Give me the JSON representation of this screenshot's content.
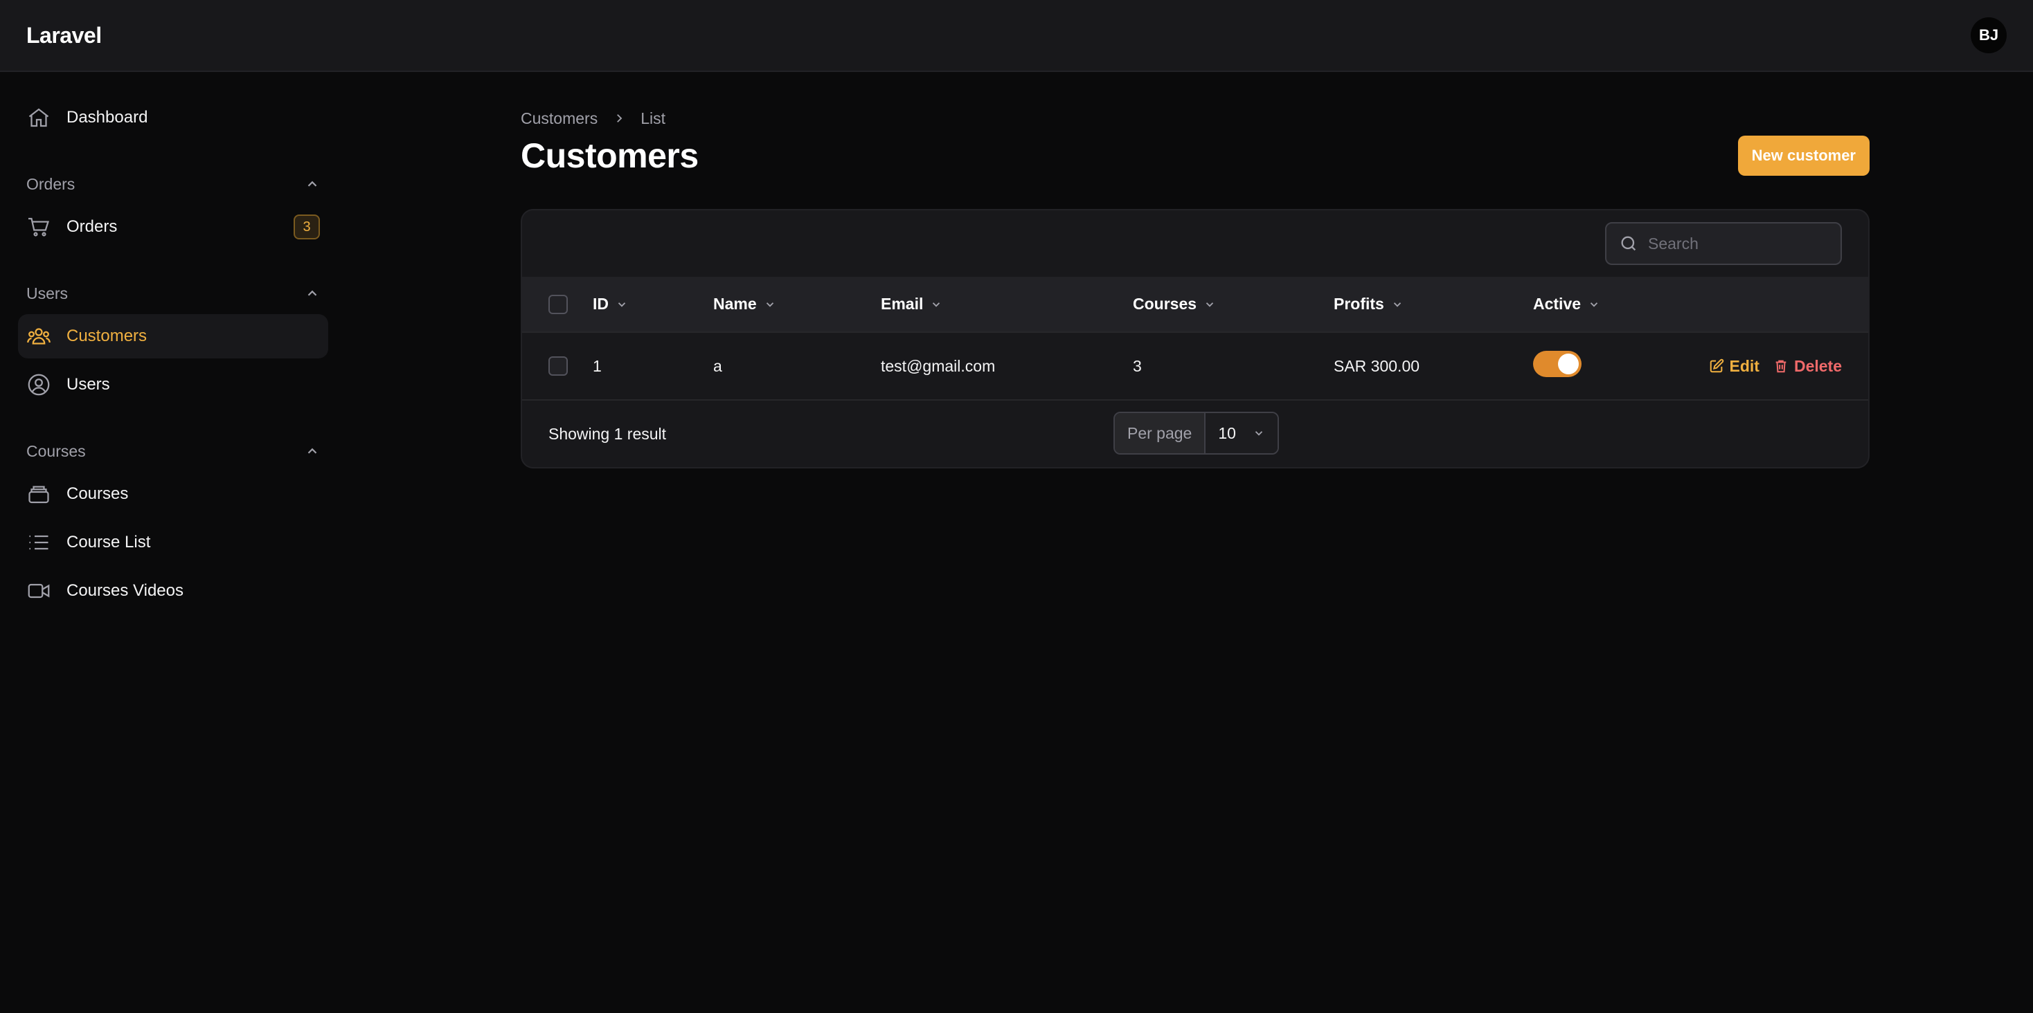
{
  "app": {
    "brand": "Laravel",
    "user_initials": "BJ"
  },
  "colors": {
    "accent": "#f0a83a",
    "accent_text": "#f0b040",
    "danger": "#f06a6a",
    "bg": "#0a0a0b",
    "surface": "#18181b"
  },
  "sidebar": {
    "dashboard": {
      "label": "Dashboard",
      "icon": "home-icon"
    },
    "groups": [
      {
        "label": "Orders",
        "items": [
          {
            "label": "Orders",
            "icon": "cart-icon",
            "badge": "3"
          }
        ]
      },
      {
        "label": "Users",
        "items": [
          {
            "label": "Customers",
            "icon": "users-group-icon",
            "active": true
          },
          {
            "label": "Users",
            "icon": "user-circle-icon"
          }
        ]
      },
      {
        "label": "Courses",
        "items": [
          {
            "label": "Courses",
            "icon": "stack-icon"
          },
          {
            "label": "Course List",
            "icon": "list-icon"
          },
          {
            "label": "Courses Videos",
            "icon": "video-icon"
          }
        ]
      }
    ]
  },
  "breadcrumb": {
    "parent": "Customers",
    "current": "List"
  },
  "page": {
    "title": "Customers",
    "new_button": "New customer"
  },
  "table": {
    "search_placeholder": "Search",
    "columns": [
      "ID",
      "Name",
      "Email",
      "Courses",
      "Profits",
      "Active"
    ],
    "rows": [
      {
        "id": "1",
        "name": "a",
        "email": "test@gmail.com",
        "courses": "3",
        "profits": "SAR 300.00",
        "active": true
      }
    ],
    "actions": {
      "edit": "Edit",
      "delete": "Delete"
    },
    "footer": {
      "showing": "Showing 1 result",
      "per_page_label": "Per page",
      "per_page_value": "10"
    }
  }
}
